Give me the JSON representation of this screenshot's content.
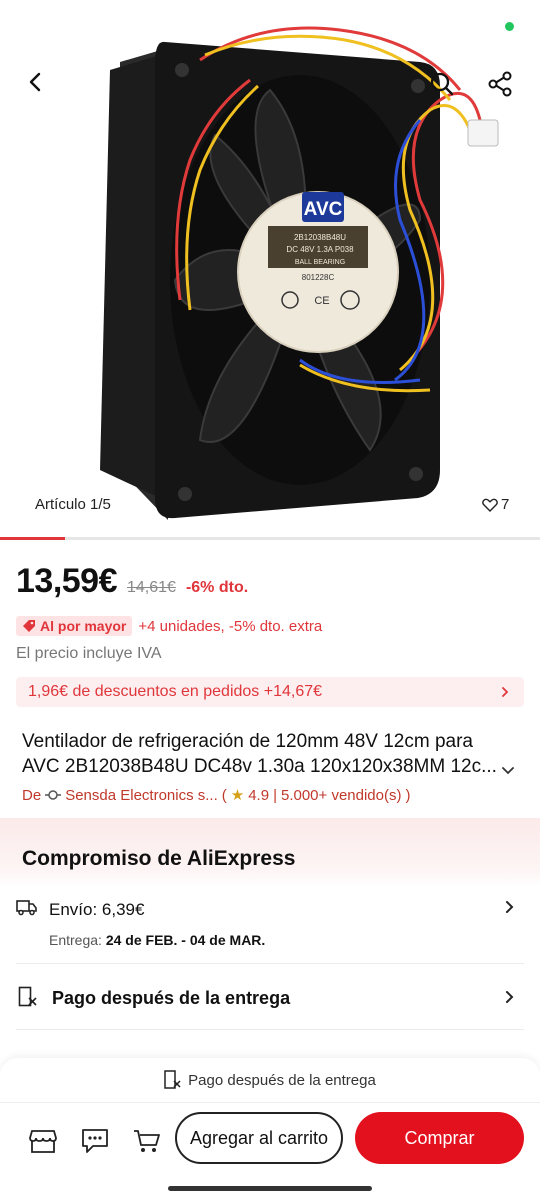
{
  "gallery": {
    "counter": "Artículo 1/5",
    "likes": "7",
    "position": 1,
    "total": 5,
    "product_label": {
      "brand": "AVC",
      "model": "2B12038B48U",
      "spec": "DC 48V 1.3A",
      "code": "P038",
      "bearing": "BALL BEARING",
      "origin": "中国制造",
      "lot": "801228C"
    }
  },
  "price": {
    "current": "13,59€",
    "original": "14,61€",
    "discount": "-6% dto."
  },
  "bulk": {
    "badge": "Al por mayor",
    "text": "+4 unidades, -5% dto. extra"
  },
  "vat_note": "El precio incluye IVA",
  "coupon": "1,96€ de descuentos en pedidos +14,67€",
  "product": {
    "title": "Ventilador de refrigeración de 120mm 48V 12cm para AVC 2B12038B48U DC48v 1.30a 120x120x38MM 12c...",
    "store_prefix": "De",
    "store_name": "Sensda Electronics s...",
    "rating": "4.9",
    "sold": "5.000+ vendido(s)"
  },
  "commitment": {
    "title": "Compromiso de AliExpress",
    "shipping_label": "Envío: 6,39€",
    "delivery_prefix": "Entrega:",
    "delivery_dates": "24 de FEB. - 04 de MAR.",
    "payment_label": "Pago después de la entrega"
  },
  "bottom": {
    "note": "Pago después de la entrega",
    "add_to_cart": "Agregar al carrito",
    "buy": "Comprar"
  },
  "colors": {
    "accent": "#e3101e",
    "price_red": "#e0363b",
    "status_dot": "#22c55e"
  },
  "icons": [
    "back-icon",
    "search-icon",
    "share-icon",
    "heart-icon",
    "tag-icon",
    "store-logo-icon",
    "star-icon",
    "truck-icon",
    "pay-later-icon",
    "store-icon",
    "chat-icon",
    "cart-icon",
    "chevron-right-icon",
    "chevron-down-icon"
  ]
}
